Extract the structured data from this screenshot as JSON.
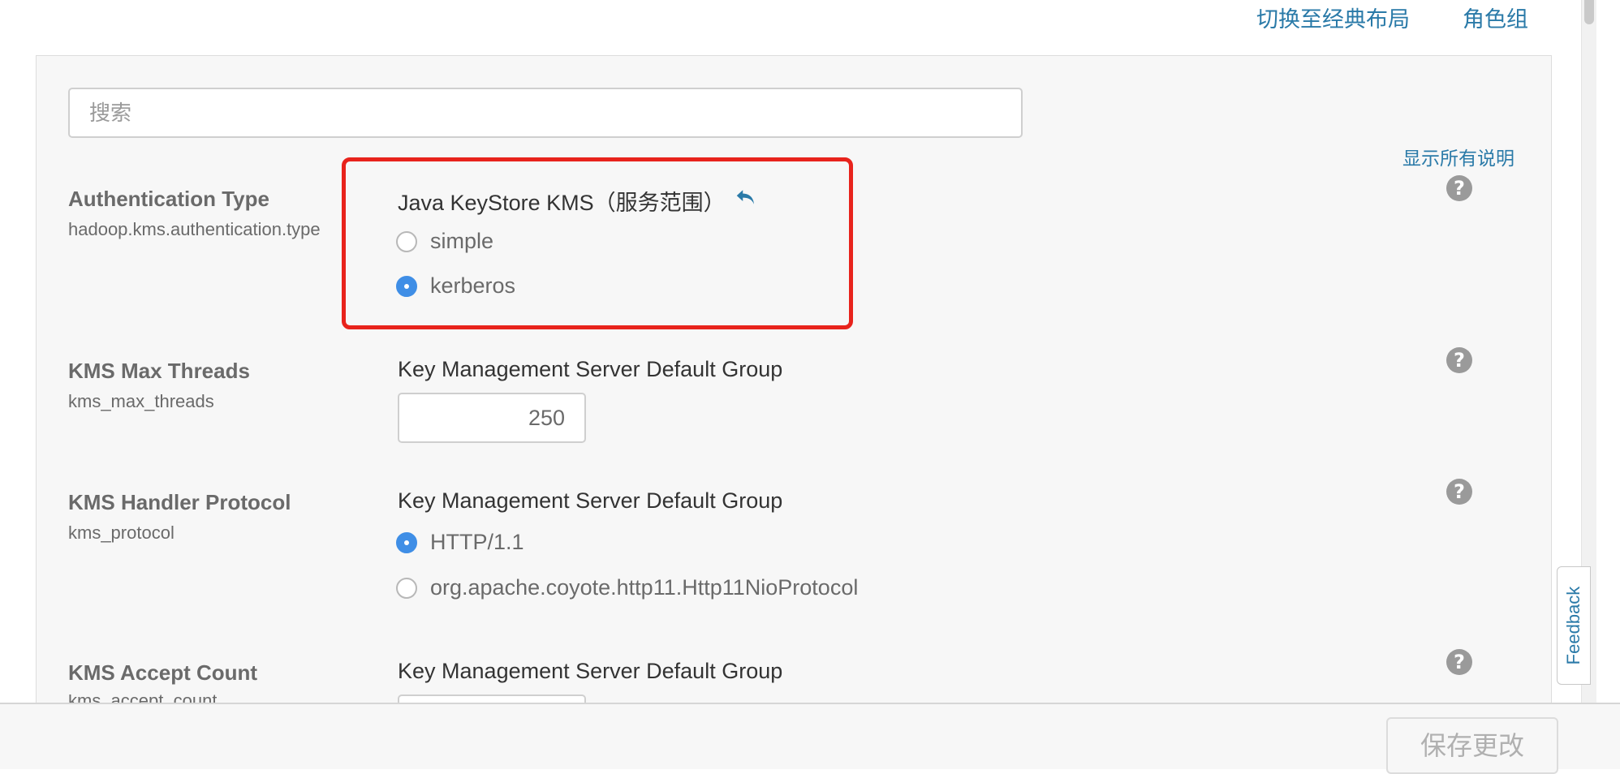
{
  "header": {
    "switch_layout_link": "切换至经典布局",
    "role_groups_link": "角色组"
  },
  "search": {
    "placeholder": "搜索",
    "value": ""
  },
  "show_all_descriptions": "显示所有说明",
  "properties": [
    {
      "name": "Authentication Type",
      "key": "hadoop.kms.authentication.type",
      "scope": "Java KeyStore KMS（服务范围）",
      "options": [
        {
          "label": "simple",
          "selected": false
        },
        {
          "label": "kerberos",
          "selected": true
        }
      ],
      "icons": [
        "revert-icon",
        "help-icon"
      ],
      "highlighted": true
    },
    {
      "name": "KMS Max Threads",
      "key": "kms_max_threads",
      "scope": "Key Management Server Default Group",
      "value": "250",
      "icons": [
        "help-icon"
      ]
    },
    {
      "name": "KMS Handler Protocol",
      "key": "kms_protocol",
      "scope": "Key Management Server Default Group",
      "options": [
        {
          "label": "HTTP/1.1",
          "selected": true
        },
        {
          "label": "org.apache.coyote.http11.Http11NioProtocol",
          "selected": false
        }
      ],
      "icons": [
        "help-icon"
      ]
    },
    {
      "name": "KMS Accept Count",
      "key": "kms_accept_count",
      "scope": "Key Management Server Default Group",
      "icons": [
        "help-icon"
      ]
    }
  ],
  "feedback_label": "Feedback",
  "footer": {
    "save_button": "保存更改"
  },
  "colors": {
    "link": "#2a7aa8",
    "radio_selected": "#3f8ee6",
    "highlight_border": "#e8231c",
    "panel_bg": "#f7f7f7"
  }
}
